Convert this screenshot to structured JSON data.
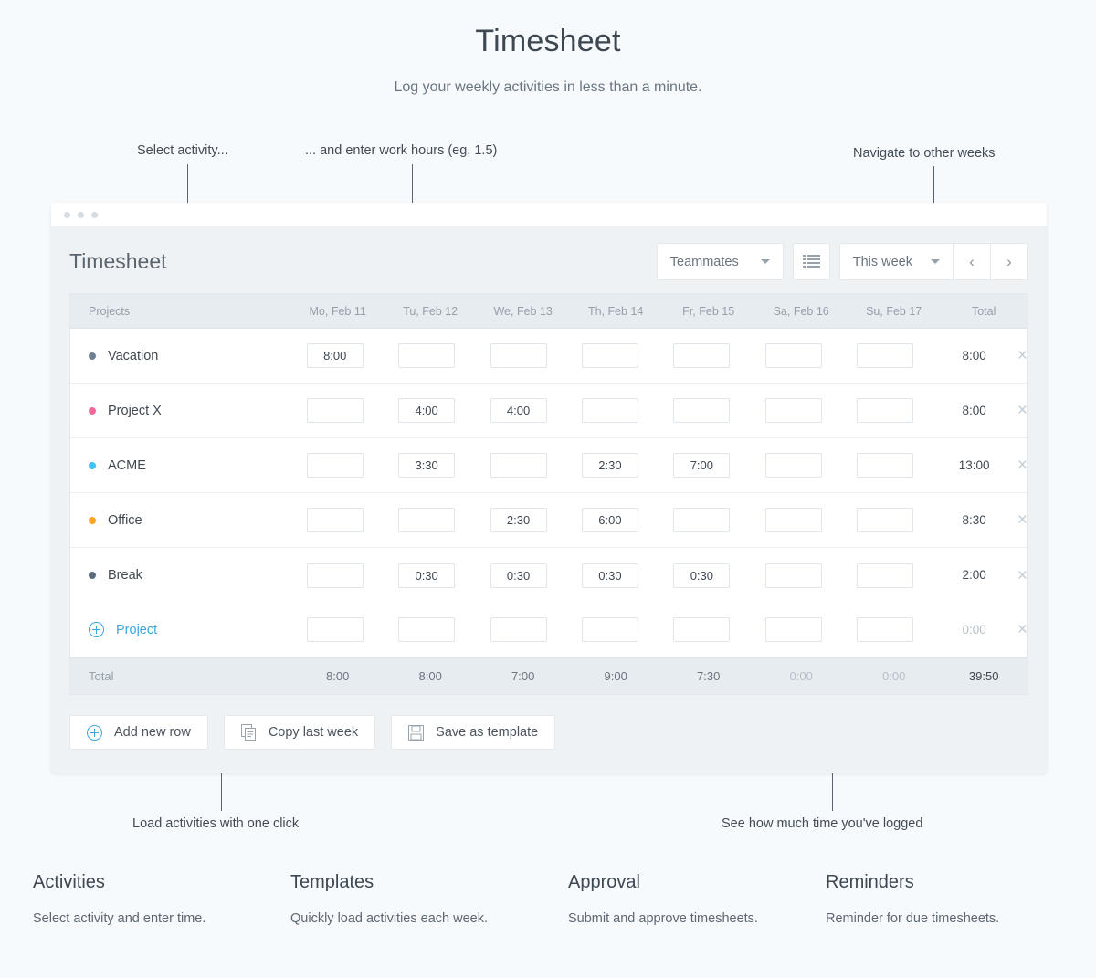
{
  "page": {
    "title": "Timesheet",
    "subtitle": "Log your weekly activities in less than a minute."
  },
  "callouts": {
    "select_activity": "Select activity...",
    "enter_hours": "... and enter work hours (eg. 1.5)",
    "navigate_weeks": "Navigate to other weeks",
    "load_activities": "Load activities with one click",
    "time_logged": "See how much time you've logged"
  },
  "app": {
    "title": "Timesheet",
    "toolbar": {
      "teammates_label": "Teammates",
      "list_icon": "list-view-icon",
      "week_label": "This week",
      "prev_label": "‹",
      "next_label": "›"
    }
  },
  "table": {
    "columns": [
      "Projects",
      "Mo, Feb 11",
      "Tu, Feb 12",
      "We, Feb 13",
      "Th, Feb 14",
      "Fr, Feb 15",
      "Sa, Feb 16",
      "Su, Feb 17",
      "Total"
    ],
    "rows": [
      {
        "name": "Vacation",
        "color": "#6e8091",
        "values": [
          "8:00",
          "",
          "",
          "",
          "",
          "",
          ""
        ],
        "total": "8:00",
        "total_zero": false
      },
      {
        "name": "Project X",
        "color": "#f2679a",
        "values": [
          "",
          "4:00",
          "4:00",
          "",
          "",
          "",
          ""
        ],
        "total": "8:00",
        "total_zero": false
      },
      {
        "name": "ACME",
        "color": "#3fc3f0",
        "values": [
          "",
          "3:30",
          "",
          "2:30",
          "7:00",
          "",
          ""
        ],
        "total": "13:00",
        "total_zero": false
      },
      {
        "name": "Office",
        "color": "#f5a623",
        "values": [
          "",
          "",
          "2:30",
          "6:00",
          "",
          "",
          ""
        ],
        "total": "8:30",
        "total_zero": false
      },
      {
        "name": "Break",
        "color": "#5a6b7c",
        "values": [
          "",
          "0:30",
          "0:30",
          "0:30",
          "0:30",
          "",
          ""
        ],
        "total": "2:00",
        "total_zero": false
      }
    ],
    "add_row": {
      "label": "Project",
      "icon": "plus-circle-icon",
      "values": [
        "",
        "",
        "",
        "",
        "",
        "",
        ""
      ],
      "total": "0:00"
    },
    "footer": {
      "label": "Total",
      "values": [
        "8:00",
        "8:00",
        "7:00",
        "9:00",
        "7:30",
        "0:00",
        "0:00"
      ],
      "zero_flags": [
        false,
        false,
        false,
        false,
        false,
        true,
        true
      ],
      "grand_total": "39:50"
    },
    "delete_icon": "×"
  },
  "actions": [
    {
      "label": "Add new row",
      "icon": "plus-circle-icon"
    },
    {
      "label": "Copy last week",
      "icon": "copy-documents-icon"
    },
    {
      "label": "Save as template",
      "icon": "floppy-disk-icon"
    }
  ],
  "features": [
    {
      "title": "Activities",
      "desc": "Select activity and enter time."
    },
    {
      "title": "Templates",
      "desc": "Quickly load activities each week."
    },
    {
      "title": "Approval",
      "desc": "Submit and approve timesheets."
    },
    {
      "title": "Reminders",
      "desc": "Reminder for due timesheets."
    }
  ]
}
